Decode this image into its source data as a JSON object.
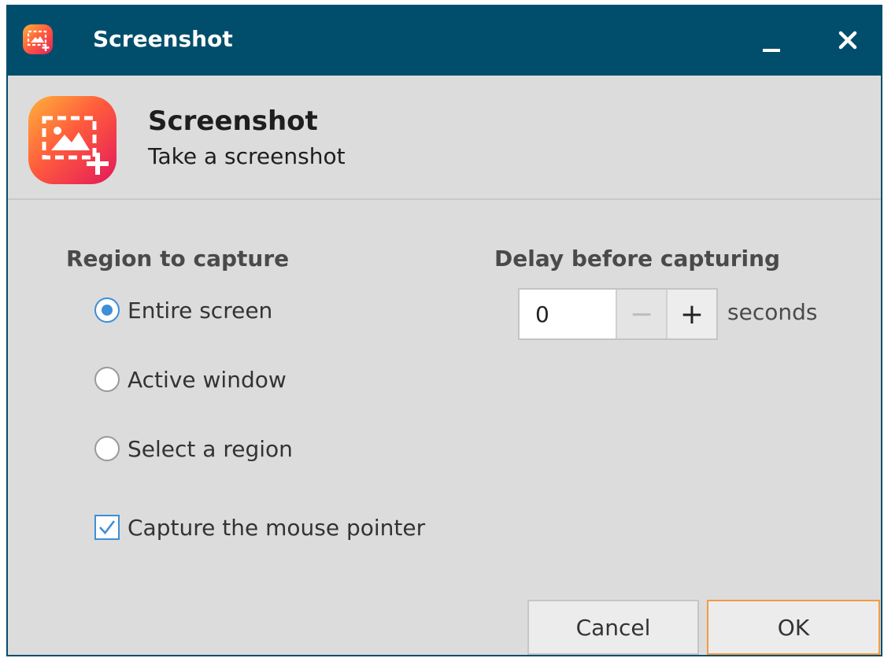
{
  "window": {
    "title": "Screenshot",
    "title_icon": "screenshot-app-icon",
    "controls": {
      "minimize_icon": "minimize-icon",
      "close_icon": "close-icon"
    }
  },
  "header": {
    "app_name": "Screenshot",
    "description": "Take a screenshot",
    "icon": "screenshot-app-icon"
  },
  "region": {
    "title": "Region to capture",
    "options": [
      {
        "label": "Entire screen",
        "selected": true
      },
      {
        "label": "Active window",
        "selected": false
      },
      {
        "label": "Select a region",
        "selected": false
      }
    ],
    "mouse_pointer": {
      "label": "Capture the mouse pointer",
      "checked": true
    }
  },
  "delay": {
    "title": "Delay before capturing",
    "value": "0",
    "unit": "seconds",
    "decrement_symbol": "−",
    "increment_symbol": "+"
  },
  "buttons": {
    "cancel": "Cancel",
    "ok": "OK"
  },
  "colors": {
    "titlebar": "#004e6c",
    "accent": "#3d8fd8",
    "ok_border": "#f39a43",
    "dialog_background": "#dcdcdc"
  }
}
